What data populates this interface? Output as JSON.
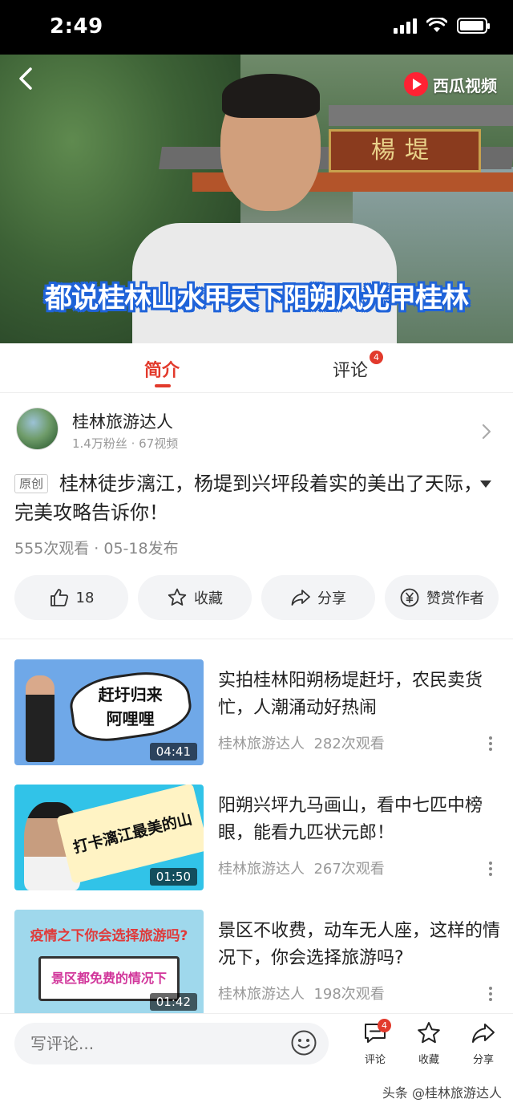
{
  "status_bar": {
    "time": "2:49",
    "battery_level": 0.95
  },
  "video": {
    "app_logo": "西瓜视频",
    "sign_text": "楊堤",
    "caption": "都说桂林山水甲天下阳朔风光甲桂林"
  },
  "tabs": {
    "intro": "简介",
    "comments": "评论",
    "comments_count": "4"
  },
  "author": {
    "name": "桂林旅游达人",
    "meta": "1.4万粉丝 · 67视频"
  },
  "video_info": {
    "tag": "原创",
    "title": "桂林徒步漓江，杨堤到兴坪段着实的美出了天际，完美攻略告诉你！",
    "views_date": "555次观看 · 05-18发布"
  },
  "actions": {
    "like": "18",
    "collect": "收藏",
    "share": "分享",
    "reward": "赞赏作者"
  },
  "related": [
    {
      "thumb_text": "赶圩归来\n阿哩哩",
      "duration": "04:41",
      "title": "实拍桂林阳朔杨堤赶圩，农民卖货忙，人潮涌动好热闹",
      "author": "桂林旅游达人",
      "views": "282次观看"
    },
    {
      "thumb_text": "打卡漓江最美的山",
      "duration": "01:50",
      "title": "阳朔兴坪九马画山，看中七匹中榜眼，能看九匹状元郎！",
      "author": "桂林旅游达人",
      "views": "267次观看"
    },
    {
      "thumb_text_top": "疫情之下你会选择旅游吗?",
      "thumb_text_frame": "景区都免费的情况下",
      "duration": "01:42",
      "title": "景区不收费，动车无人座，这样的情况下，你会选择旅游吗?",
      "author": "桂林旅游达人",
      "views": "198次观看"
    }
  ],
  "bottom_bar": {
    "comment_placeholder": "写评论...",
    "comment_label": "评论",
    "comment_badge": "4",
    "collect_label": "收藏",
    "share_label": "分享",
    "watermark": "头条 @桂林旅游达人"
  },
  "colors": {
    "accent": "#e23a2c",
    "caption_outline": "#1f63d9"
  }
}
